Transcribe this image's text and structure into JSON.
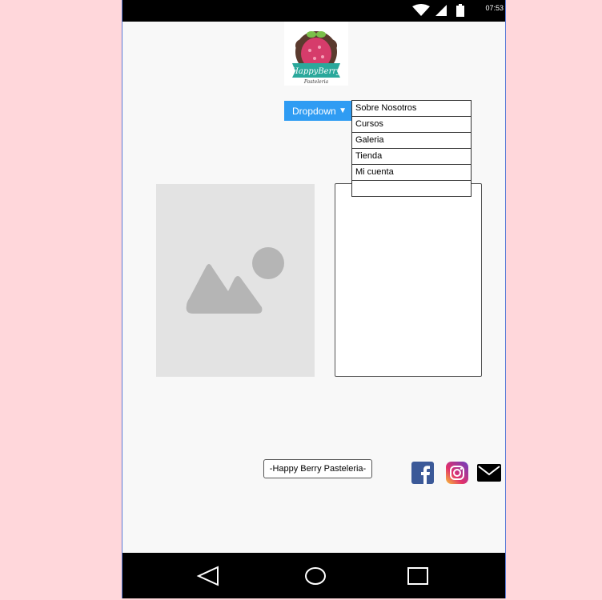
{
  "status_bar": {
    "time": "07:53",
    "icons": [
      "wifi-icon",
      "signal-icon",
      "battery-icon"
    ]
  },
  "logo": {
    "brand_top": "HappyBerry",
    "brand_bottom": "Pasteleria"
  },
  "dropdown": {
    "label": "Dropdown",
    "arrow": "▼",
    "items": [
      "Sobre Nosotros",
      "Cursos",
      "Galeria",
      "Tienda",
      "Mi cuenta",
      ""
    ]
  },
  "footer": {
    "label": "-Happy Berry Pasteleria-"
  },
  "social": [
    "facebook-icon",
    "instagram-icon",
    "mail-icon"
  ],
  "nav_bar": [
    "back-icon",
    "home-icon",
    "recents-icon"
  ],
  "colors": {
    "background": "#ffd7db",
    "screen": "#f8f8f8",
    "dropdown_button": "#2f9cf3",
    "phone_border": "#5b7bd6",
    "placeholder": "#e3e3e3"
  }
}
